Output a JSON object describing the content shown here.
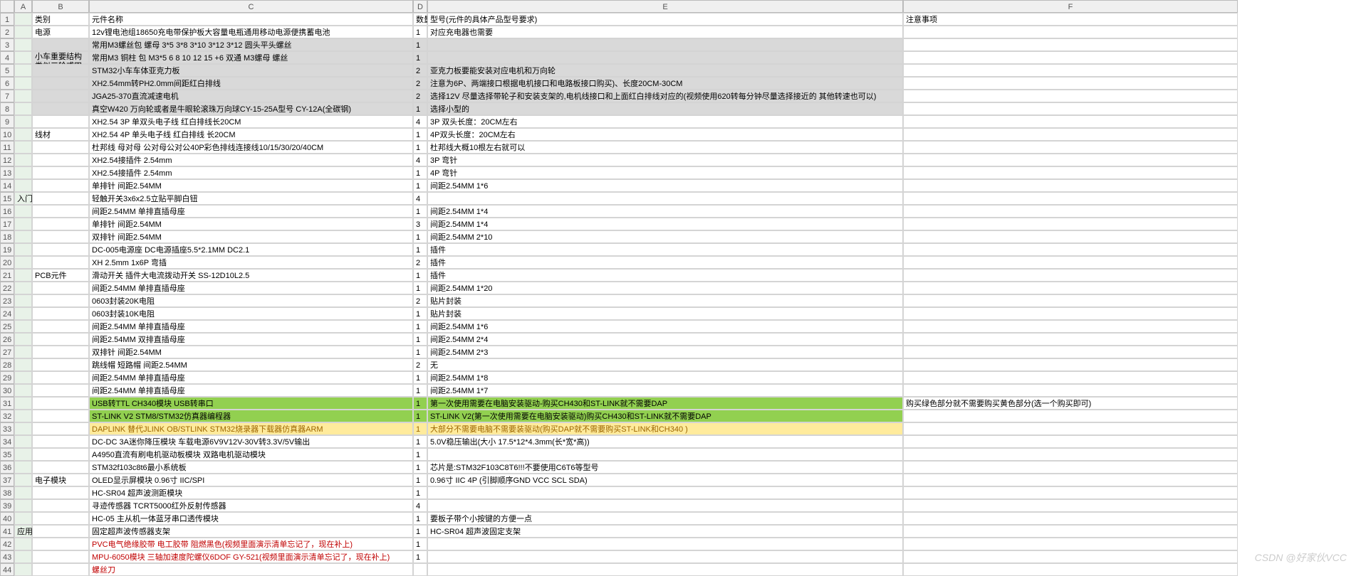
{
  "column_headers": [
    "",
    "A",
    "B",
    "C",
    "D",
    "E",
    "F"
  ],
  "rows": [
    {
      "rn": "1",
      "a": "",
      "b": "类别",
      "c": "元件名称",
      "d": "数量",
      "e": "型号(元件的具体产品型号要求)",
      "f": "注意事项"
    },
    {
      "rn": "2",
      "a": "",
      "b": "电源",
      "c": "12v锂电池组18650充电带保护板大容量电瓶通用移动电源便携蓄电池",
      "d": "1",
      "e": "对应充电器也需要",
      "f": ""
    },
    {
      "rn": "3",
      "a": "",
      "b": "",
      "c": "常用M3螺丝包 螺母 3*5 3*8 3*10 3*12 3*12 圆头平头螺丝",
      "d": "1",
      "e": "",
      "f": "",
      "gray": true
    },
    {
      "rn": "4",
      "a": "",
      "b_merge": "小车重要结构 类似三轮或四轮结构均可",
      "c": "常用M3 铜柱 包 M3*5 6 8 10 12 15 +6 双通 M3螺母 螺丝",
      "d": "1",
      "e": "",
      "f": "",
      "gray": true
    },
    {
      "rn": "5",
      "a": "",
      "b": "",
      "c": "STM32小车车体亚克力板",
      "d": "2",
      "e": "亚克力板要能安装对应电机和万向轮",
      "f": "",
      "gray": true
    },
    {
      "rn": "6",
      "a": "",
      "b": "",
      "c": "XH2.54mm转PH2.0mm间距红白排线",
      "d": "2",
      "e": "注意为6P、两端接口根据电机接口和电路板接口购买)、长度20CM-30CM",
      "f": "",
      "gray": true
    },
    {
      "rn": "7",
      "a": "",
      "b": "",
      "c": "JGA25-370直流减速电机",
      "d": "2",
      "e": "选择12V 尽量选择带轮子和安装支架的,电机线接口和上面红白排线对应的(视频使用620转每分钟尽量选择接近的 其他转速也可以)",
      "f": "",
      "gray": true
    },
    {
      "rn": "8",
      "a": "",
      "b": "",
      "c": "真空W420 万向轮或者是牛眼轮滚珠万向球CY-15-25A型号 CY-12A(全碳钢)",
      "d": "1",
      "e": "选择小型的",
      "f": "",
      "gray": true
    },
    {
      "rn": "9",
      "a": "",
      "b": "",
      "c": "XH2.54 3P 单双头电子线 红白排线长20CM",
      "d": "4",
      "e": "3P 双头长度：20CM左右",
      "f": ""
    },
    {
      "rn": "10",
      "a": "",
      "b": "线材",
      "c": "XH2.54 4P  单头电子线 红白排线 长20CM",
      "d": "1",
      "e": "4P双头长度：20CM左右",
      "f": ""
    },
    {
      "rn": "11",
      "a": "",
      "b": "",
      "c": "杜邦线 母对母 公对母公对公40P彩色排线连接线10/15/30/20/40CM",
      "d": "1",
      "e": "杜邦线大概10根左右就可以",
      "f": ""
    },
    {
      "rn": "12",
      "a": "",
      "b": "",
      "c": "XH2.54接插件 2.54mm",
      "d": "4",
      "e": "3P  弯针",
      "f": ""
    },
    {
      "rn": "13",
      "a": "",
      "b": "",
      "c": "XH2.54接插件 2.54mm",
      "d": "1",
      "e": "4P 弯针",
      "f": ""
    },
    {
      "rn": "14",
      "a": "",
      "b": "",
      "c": "单排针 间距2.54MM",
      "d": "1",
      "e": "间距2.54MM 1*6",
      "f": ""
    },
    {
      "rn": "15",
      "a": "入门",
      "b": "",
      "c": "轻触开关3x6x2.5立贴平脚白钮",
      "d": "4",
      "e": "",
      "f": ""
    },
    {
      "rn": "16",
      "a": "",
      "b": "",
      "c": "间距2.54MM 单排直插母座",
      "d": "1",
      "e": "间距2.54MM 1*4",
      "f": ""
    },
    {
      "rn": "17",
      "a": "",
      "b": "",
      "c": "单排针 间距2.54MM",
      "d": "3",
      "e": "间距2.54MM 1*4",
      "f": ""
    },
    {
      "rn": "18",
      "a": "",
      "b": "",
      "c": "双排针 间距2.54MM",
      "d": "1",
      "e": "间距2.54MM 2*10",
      "f": ""
    },
    {
      "rn": "19",
      "a": "",
      "b": "",
      "c": "DC-005电源座 DC电源插座5.5*2.1MM DC2.1",
      "d": "1",
      "e": "插件",
      "f": ""
    },
    {
      "rn": "20",
      "a": "",
      "b": "",
      "c": "XH 2.5mm 1x6P 弯插",
      "d": "2",
      "e": "插件",
      "f": ""
    },
    {
      "rn": "21",
      "a": "",
      "b": "PCB元件",
      "c": "滑动开关 插件大电流拨动开关 SS-12D10L2.5",
      "d": "1",
      "e": "插件",
      "f": ""
    },
    {
      "rn": "22",
      "a": "",
      "b": "",
      "c": "间距2.54MM 单排直插母座",
      "d": "1",
      "e": "间距2.54MM 1*20",
      "f": ""
    },
    {
      "rn": "23",
      "a": "",
      "b": "",
      "c": "0603封装20K电阻",
      "d": "2",
      "e": "贴片封装",
      "f": ""
    },
    {
      "rn": "24",
      "a": "",
      "b": "",
      "c": "0603封装10K电阻",
      "d": "1",
      "e": "贴片封装",
      "f": ""
    },
    {
      "rn": "25",
      "a": "",
      "b": "",
      "c": "间距2.54MM 单排直插母座",
      "d": "1",
      "e": "间距2.54MM 1*6",
      "f": ""
    },
    {
      "rn": "26",
      "a": "",
      "b": "",
      "c": "间距2.54MM 双排直插母座",
      "d": "1",
      "e": "间距2.54MM 2*4",
      "f": ""
    },
    {
      "rn": "27",
      "a": "",
      "b": "",
      "c": "双排针 间距2.54MM",
      "d": "1",
      "e": "间距2.54MM 2*3",
      "f": ""
    },
    {
      "rn": "28",
      "a": "",
      "b": "",
      "c": "跳线帽 短路帽 间距2.54MM",
      "d": "2",
      "e": "无",
      "f": ""
    },
    {
      "rn": "29",
      "a": "",
      "b": "",
      "c": "间距2.54MM 单排直插母座",
      "d": "1",
      "e": "间距2.54MM 1*8",
      "f": ""
    },
    {
      "rn": "30",
      "a": "",
      "b": "",
      "c": "间距2.54MM 单排直插母座",
      "d": "1",
      "e": "间距2.54MM 1*7",
      "f": ""
    },
    {
      "rn": "31",
      "a": "",
      "b": "",
      "c": "USB转TTL CH340模块 USB转串口",
      "d": "1",
      "e": "第一次使用需要在电脑安装驱动-购买CH430和ST-LINK就不需要DAP",
      "f": "购买绿色部分就不需要购买黄色部分(选一个购买即可)",
      "hl": "green"
    },
    {
      "rn": "32",
      "a": "",
      "b": "",
      "c": "ST-LINK V2 STM8/STM32仿真器编程器",
      "d": "1",
      "e": "ST-LINK V2(第一次使用需要在电脑安装驱动)购买CH430和ST-LINK就不需要DAP",
      "f": "",
      "hl": "green"
    },
    {
      "rn": "33",
      "a": "",
      "b": "",
      "c": "DAPLINK 替代JLINK OB/STLINK STM32烧录器下载器仿真器ARM",
      "d": "1",
      "e": "大部分不需要电脑不需要装驱动(购买DAP就不需要购买ST-LINK和CH340 )",
      "f": "",
      "hl": "yellow"
    },
    {
      "rn": "34",
      "a": "",
      "b": "",
      "c": "DC-DC 3A迷你降压模块 车载电源6V9V12V-30V转3.3V/5V输出",
      "d": "1",
      "e": "5.0V稳压输出(大小 17.5*12*4.3mm(长*宽*高))",
      "f": ""
    },
    {
      "rn": "35",
      "a": "",
      "b": "",
      "c": "A4950直流有刷电机驱动板模块 双路电机驱动模块",
      "d": "1",
      "e": "",
      "f": ""
    },
    {
      "rn": "36",
      "a": "",
      "b": "",
      "c": "STM32f103c8t6最小系统板",
      "d": "1",
      "e": "芯片是:STM32F103C8T6!!!不要使用C6T6等型号",
      "f": ""
    },
    {
      "rn": "37",
      "a": "",
      "b": "电子模块",
      "c": "OLED显示屏模块 0.96寸 IIC/SPI",
      "d": "1",
      "e": "0.96寸 IIC 4P (引脚顺序GND VCC SCL SDA)",
      "f": ""
    },
    {
      "rn": "38",
      "a": "",
      "b": "",
      "c": "HC-SR04 超声波测距模块",
      "d": "1",
      "e": "",
      "f": ""
    },
    {
      "rn": "39",
      "a": "",
      "b": "",
      "c": "寻迹传感器 TCRT5000红外反射传感器",
      "d": "4",
      "e": "",
      "f": ""
    },
    {
      "rn": "40",
      "a": "",
      "b": "",
      "c": "HC-05 主从机一体蓝牙串口透传模块",
      "d": "1",
      "e": "要板子带个小按键的方便一点",
      "f": ""
    },
    {
      "rn": "41",
      "a": "应用",
      "b": "",
      "c": "固定超声波传感器支架",
      "d": "1",
      "e": "HC-SR04 超声波固定支架",
      "f": ""
    },
    {
      "rn": "42",
      "a": "",
      "b": "",
      "c": "PVC电气绝缘胶带 电工胶带 阻燃黑色(视频里面演示清单忘记了，现在补上)",
      "d": "1",
      "e": "",
      "f": "",
      "red": true
    },
    {
      "rn": "43",
      "a": "",
      "b": "",
      "c": "MPU-6050模块 三轴加速度陀螺仪6DOF GY-521(视频里面演示清单忘记了，现在补上)",
      "d": "1",
      "e": "",
      "f": "",
      "red": true
    },
    {
      "rn": "44",
      "a": "",
      "b": "",
      "c": "螺丝刀",
      "d": "",
      "e": "",
      "f": "",
      "red": true
    }
  ],
  "watermark": "CSDN @好家伙VCC"
}
